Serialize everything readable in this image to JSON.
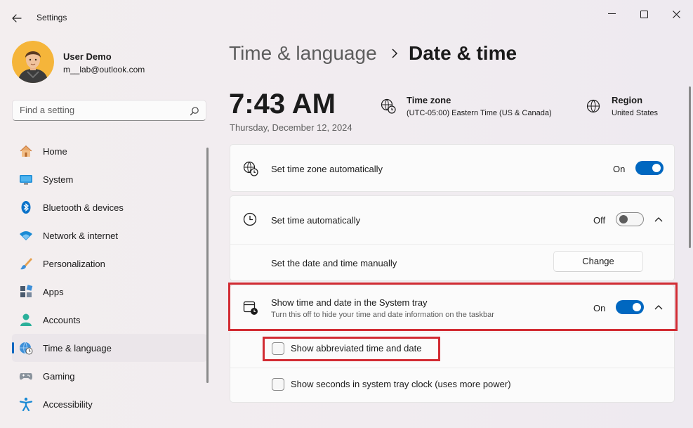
{
  "window": {
    "title": "Settings"
  },
  "profile": {
    "name": "User Demo",
    "email": "m__lab@outlook.com"
  },
  "search": {
    "placeholder": "Find a setting"
  },
  "nav": {
    "items": [
      {
        "label": "Home",
        "icon": "home-icon"
      },
      {
        "label": "System",
        "icon": "system-icon"
      },
      {
        "label": "Bluetooth & devices",
        "icon": "bluetooth-icon"
      },
      {
        "label": "Network & internet",
        "icon": "wifi-icon"
      },
      {
        "label": "Personalization",
        "icon": "brush-icon"
      },
      {
        "label": "Apps",
        "icon": "apps-icon"
      },
      {
        "label": "Accounts",
        "icon": "accounts-icon"
      },
      {
        "label": "Time & language",
        "icon": "globe-clock-icon",
        "active": true
      },
      {
        "label": "Gaming",
        "icon": "gamepad-icon"
      },
      {
        "label": "Accessibility",
        "icon": "accessibility-icon"
      }
    ]
  },
  "header": {
    "parent": "Time & language",
    "current": "Date & time"
  },
  "summary": {
    "time": "7:43 AM",
    "date": "Thursday, December 12, 2024",
    "timezone_title": "Time zone",
    "timezone_value": "(UTC-05:00) Eastern Time (US & Canada)",
    "region_title": "Region",
    "region_value": "United States"
  },
  "settings": {
    "tz_auto": {
      "label": "Set time zone automatically",
      "state": "On"
    },
    "time_auto": {
      "label": "Set time automatically",
      "state": "Off"
    },
    "manual": {
      "label": "Set the date and time manually",
      "button": "Change"
    },
    "tray": {
      "label": "Show time and date in the System tray",
      "description": "Turn this off to hide your time and date information on the taskbar",
      "state": "On"
    },
    "abbreviated": {
      "label": "Show abbreviated time and date"
    },
    "seconds": {
      "label": "Show seconds in system tray clock (uses more power)"
    }
  },
  "colors": {
    "accent": "#0067c0",
    "highlight": "#d22c33"
  }
}
